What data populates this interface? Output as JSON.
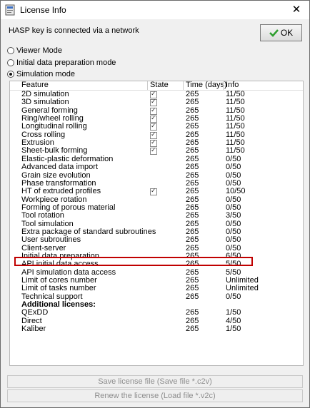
{
  "window": {
    "title": "License Info",
    "close_glyph": "✕"
  },
  "hasp_status": "HASP key is connected via a network",
  "ok_label": "OK",
  "modes": [
    {
      "label": "Viewer Mode",
      "selected": false
    },
    {
      "label": "Initial data preparation mode",
      "selected": false
    },
    {
      "label": "Simulation mode",
      "selected": true
    }
  ],
  "table": {
    "headers": {
      "feature": "Feature",
      "state": "State",
      "time": "Time (days)",
      "info": "Info"
    },
    "rows": [
      {
        "feature": "2D simulation",
        "state": true,
        "time": "265",
        "info": "11/50"
      },
      {
        "feature": "3D simulation",
        "state": true,
        "time": "265",
        "info": "11/50"
      },
      {
        "feature": "General forming",
        "state": true,
        "time": "265",
        "info": "11/50"
      },
      {
        "feature": "Ring/wheel rolling",
        "state": true,
        "time": "265",
        "info": "11/50"
      },
      {
        "feature": "Longitudinal rolling",
        "state": true,
        "time": "265",
        "info": "11/50"
      },
      {
        "feature": "Cross rolling",
        "state": true,
        "time": "265",
        "info": "11/50"
      },
      {
        "feature": "Extrusion",
        "state": true,
        "time": "265",
        "info": "11/50"
      },
      {
        "feature": "Sheet-bulk forming",
        "state": true,
        "time": "265",
        "info": "11/50"
      },
      {
        "feature": "Elastic-plastic deformation",
        "state": false,
        "time": "265",
        "info": "0/50"
      },
      {
        "feature": "Advanced data import",
        "state": false,
        "time": "265",
        "info": "0/50"
      },
      {
        "feature": "Grain size evolution",
        "state": false,
        "time": "265",
        "info": "0/50"
      },
      {
        "feature": "Phase transformation",
        "state": false,
        "time": "265",
        "info": "0/50"
      },
      {
        "feature": "HT of extruded profiles",
        "state": true,
        "time": "265",
        "info": "10/50"
      },
      {
        "feature": "Workpiece rotation",
        "state": false,
        "time": "265",
        "info": "0/50"
      },
      {
        "feature": "Forming of porous material",
        "state": false,
        "time": "265",
        "info": "0/50"
      },
      {
        "feature": "Tool rotation",
        "state": false,
        "time": "265",
        "info": "3/50"
      },
      {
        "feature": "Tool simulation",
        "state": false,
        "time": "265",
        "info": "0/50"
      },
      {
        "feature": "Extra package of standard subroutines",
        "state": false,
        "time": "265",
        "info": "0/50"
      },
      {
        "feature": "User subroutines",
        "state": false,
        "time": "265",
        "info": "0/50"
      },
      {
        "feature": "Client-server",
        "state": false,
        "time": "265",
        "info": "0/50"
      },
      {
        "feature": "Initial data preparation",
        "state": false,
        "time": "265",
        "info": "6/50"
      },
      {
        "feature": "API initial data access",
        "state": false,
        "time": "265",
        "info": "5/50"
      },
      {
        "feature": "API simulation data access",
        "state": false,
        "time": "265",
        "info": "5/50"
      },
      {
        "feature": "Limit of cores number",
        "state": false,
        "time": "265",
        "info": "Unlimited"
      },
      {
        "feature": "Limit of tasks number",
        "state": false,
        "time": "265",
        "info": "Unlimited"
      },
      {
        "feature": "Technical support",
        "state": false,
        "time": "265",
        "info": "0/50"
      },
      {
        "feature": "Additional licenses:",
        "state": false,
        "time": "",
        "info": "",
        "bold": true
      },
      {
        "feature": "QExDD",
        "state": false,
        "time": "265",
        "info": "1/50"
      },
      {
        "feature": "Direct",
        "state": false,
        "time": "265",
        "info": "4/50"
      },
      {
        "feature": "Kaliber",
        "state": false,
        "time": "265",
        "info": "1/50"
      }
    ]
  },
  "buttons": {
    "save": "Save license file (Save file *.c2v)",
    "renew": "Renew the license (Load file *.v2c)"
  },
  "colors": {
    "highlight": "#c00000",
    "ok_check": "#2e9e2e"
  },
  "icons": {
    "app": "app-icon",
    "close": "close-icon",
    "ok": "check-icon"
  }
}
